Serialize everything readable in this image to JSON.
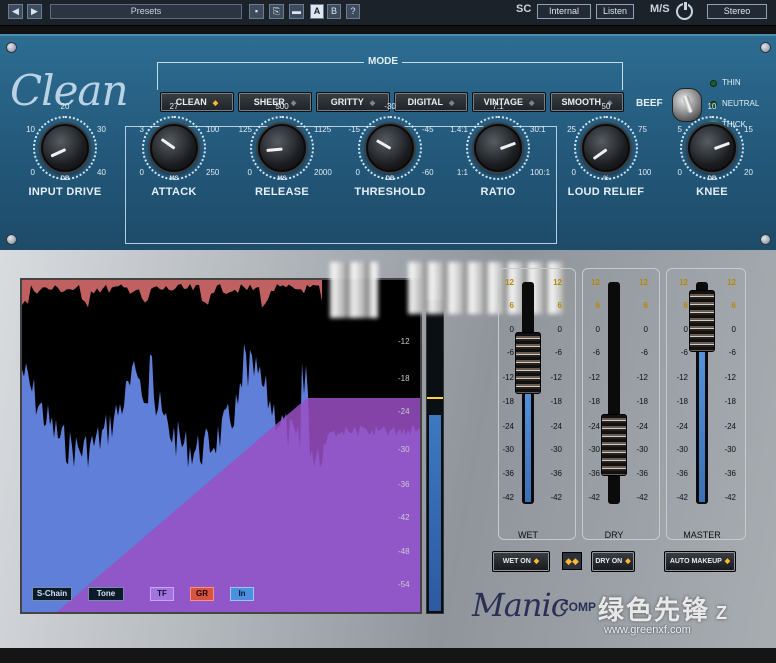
{
  "topbar": {
    "presets": "Presets",
    "ab_a": "A",
    "ab_b": "B",
    "help": "?",
    "sc_label": "SC",
    "sc_source": "Internal",
    "listen": "Listen",
    "ms_label": "M/S",
    "stereo": "Stereo"
  },
  "plugin": {
    "logo": "Clean",
    "mode_label": "MODE",
    "modes": [
      "CLEAN",
      "SHEER",
      "GRITTY",
      "DIGITAL",
      "VINTAGE",
      "SMOOTH"
    ],
    "active_mode": "CLEAN",
    "beef_label": "BEEF",
    "beef_options": [
      "THIN",
      "NEUTRAL",
      "THICK"
    ],
    "beef_selected": "THICK"
  },
  "knobs": [
    {
      "label": "INPUT DRIVE",
      "min": "0",
      "max": "40",
      "lmid": "10",
      "rmid": "30",
      "top": "20",
      "unit": "DB"
    },
    {
      "label": "ATTACK",
      "min": "0",
      "max": "250",
      "lmid": "3",
      "rmid": "100",
      "top": "27",
      "unit": "MS"
    },
    {
      "label": "RELEASE",
      "min": "0",
      "max": "2000",
      "lmid": "125",
      "rmid": "1125",
      "top": "500",
      "unit": "MS"
    },
    {
      "label": "THRESHOLD",
      "min": "0",
      "max": "-60",
      "lmid": "-15",
      "rmid": "-45",
      "top": "-30",
      "unit": "DB"
    },
    {
      "label": "RATIO",
      "min": "1:1",
      "max": "100:1",
      "lmid": "1.4:1",
      "rmid": "30:1",
      "top": "7:1",
      "unit": ""
    },
    {
      "label": "LOUD RELIEF",
      "min": "0",
      "max": "100",
      "lmid": "25",
      "rmid": "75",
      "top": "50",
      "unit": "%"
    },
    {
      "label": "KNEE",
      "min": "0",
      "max": "20",
      "lmid": "5",
      "rmid": "15",
      "top": "10",
      "unit": "DB"
    }
  ],
  "display": {
    "buttons": [
      "S-Chain",
      "Tone",
      "TF",
      "GR",
      "In"
    ],
    "scale": [
      "-12",
      "-18",
      "-24",
      "-30",
      "-36",
      "-42",
      "-48",
      "-54"
    ]
  },
  "faders": {
    "scale": [
      "12",
      "6",
      "0",
      "-6",
      "-12",
      "-18",
      "-24",
      "-30",
      "-36",
      "-42"
    ],
    "channels": [
      {
        "name": "WET",
        "button": "WET ON"
      },
      {
        "name": "DRY",
        "button": "DRY ON"
      },
      {
        "name": "MASTER",
        "button": "AUTO MAKEUP"
      }
    ],
    "link": "◆◆"
  },
  "branding": {
    "manic": "Manic",
    "comp": "COMP",
    "watermark": "绿色先锋",
    "watermark_url": "www.greenxf.com",
    "watermark_z": "Z"
  }
}
